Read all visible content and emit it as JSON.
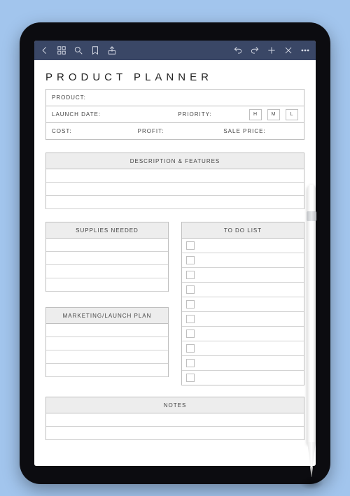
{
  "planner": {
    "title": "PRODUCT PLANNER",
    "labels": {
      "product": "PRODUCT:",
      "launchDate": "LAUNCH DATE:",
      "priority": "PRIORITY:",
      "cost": "COST:",
      "profit": "PROFIT:",
      "salePrice": "SALE PRICE:"
    },
    "priorityOptions": {
      "h": "H",
      "m": "M",
      "l": "L"
    },
    "sections": {
      "desc": "DESCRIPTION & FEATURES",
      "supplies": "SUPPLIES NEEDED",
      "launch": "MARKETING/LAUNCH PLAN",
      "todo": "TO DO LIST",
      "notes": "NOTES"
    }
  }
}
